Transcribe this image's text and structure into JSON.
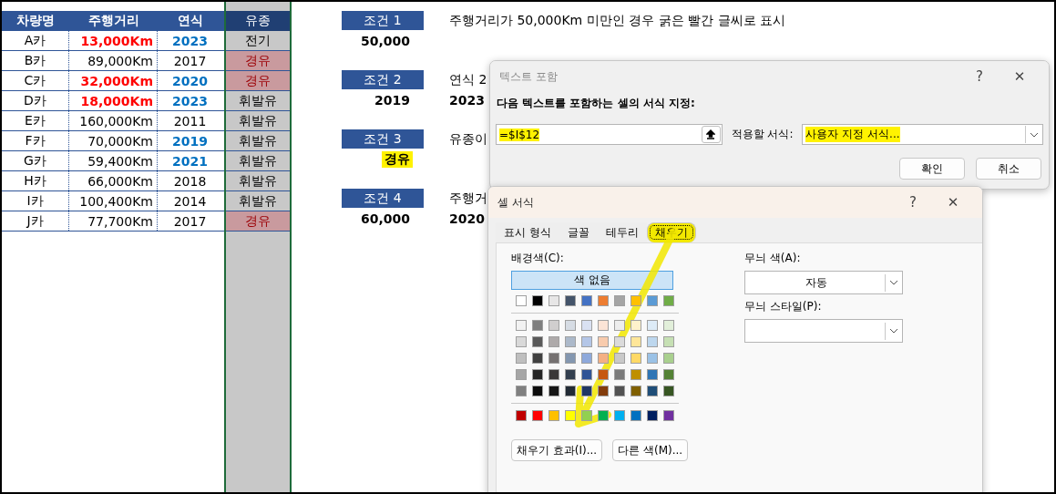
{
  "table": {
    "columns": [
      "차량명",
      "주행거리",
      "연식"
    ],
    "rows": [
      {
        "name": "A카",
        "distance": "13,000Km",
        "distance_flagged": true,
        "year": "2023",
        "year_flagged": true
      },
      {
        "name": "B카",
        "distance": "89,000Km",
        "distance_flagged": false,
        "year": "2017",
        "year_flagged": false
      },
      {
        "name": "C카",
        "distance": "32,000Km",
        "distance_flagged": true,
        "year": "2020",
        "year_flagged": true
      },
      {
        "name": "D카",
        "distance": "18,000Km",
        "distance_flagged": true,
        "year": "2023",
        "year_flagged": true
      },
      {
        "name": "E카",
        "distance": "160,000Km",
        "distance_flagged": false,
        "year": "2011",
        "year_flagged": false
      },
      {
        "name": "F카",
        "distance": "70,000Km",
        "distance_flagged": false,
        "year": "2019",
        "year_flagged": true
      },
      {
        "name": "G카",
        "distance": "59,400Km",
        "distance_flagged": false,
        "year": "2021",
        "year_flagged": true
      },
      {
        "name": "H카",
        "distance": "66,000Km",
        "distance_flagged": false,
        "year": "2018",
        "year_flagged": false
      },
      {
        "name": "I카",
        "distance": "100,400Km",
        "distance_flagged": false,
        "year": "2014",
        "year_flagged": false
      },
      {
        "name": "J카",
        "distance": "77,700Km",
        "distance_flagged": false,
        "year": "2017",
        "year_flagged": false
      }
    ]
  },
  "fuel_column": {
    "heading": "유종",
    "cells": [
      {
        "text": "전기",
        "flagged": false
      },
      {
        "text": "경유",
        "flagged": true
      },
      {
        "text": "경유",
        "flagged": true
      },
      {
        "text": "휘발유",
        "flagged": false
      },
      {
        "text": "휘발유",
        "flagged": false
      },
      {
        "text": "휘발유",
        "flagged": false
      },
      {
        "text": "휘발유",
        "flagged": false
      },
      {
        "text": "휘발유",
        "flagged": false
      },
      {
        "text": "휘발유",
        "flagged": false
      },
      {
        "text": "경유",
        "flagged": true
      }
    ]
  },
  "conditions": [
    {
      "label": "조건 1",
      "value": "50,000",
      "highlighted": false,
      "description": "주행거리가 50,000Km 미만인 경우 굵은 빨간 글씨로 표시"
    },
    {
      "label": "조건 2",
      "value": "2019",
      "highlighted": false,
      "description": "연식 2",
      "value_2": "2023"
    },
    {
      "label": "조건 3",
      "value": "경유",
      "highlighted": true,
      "description": "유종이"
    },
    {
      "label": "조건 4",
      "value": "60,000",
      "highlighted": false,
      "description": "주행거",
      "value_2": "2020"
    }
  ],
  "text_dialog": {
    "title": "텍스트 포함",
    "help": "?",
    "close": "✕",
    "prompt": "다음 텍스트를 포함하는 셀의 서식 지정:",
    "input_value": "=$I$12",
    "input_highlighted": true,
    "format_label": "적용할 서식:",
    "format_value": "사용자 지정 서식...",
    "format_highlighted": true,
    "buttons": [
      "확인",
      "취소"
    ]
  },
  "format_dialog": {
    "title": "셀 서식",
    "help": "?",
    "close": "✕",
    "tabs": [
      {
        "label": "표시 형식",
        "selected": false,
        "highlighted": false
      },
      {
        "label": "글꼴",
        "selected": false,
        "highlighted": false
      },
      {
        "label": "테두리",
        "selected": false,
        "highlighted": false
      },
      {
        "label": "채우기",
        "selected": true,
        "highlighted": true
      }
    ],
    "background_label": "배경색(C):",
    "no_color_button": "색 없음",
    "theme_colors": [
      {
        "color": "#ffffff"
      },
      {
        "color": "#000000"
      },
      {
        "color": "#e7e6e6"
      },
      {
        "color": "#44546a"
      },
      {
        "color": "#4472c4"
      },
      {
        "color": "#ed7d31"
      },
      {
        "color": "#a5a5a5"
      },
      {
        "color": "#ffc000"
      },
      {
        "color": "#5b9bd5"
      },
      {
        "color": "#70ad47"
      }
    ],
    "tint_rows": [
      [
        {
          "color": "#f2f2f2"
        },
        {
          "color": "#7f7f7f"
        },
        {
          "color": "#d0cece"
        },
        {
          "color": "#d6dce4"
        },
        {
          "color": "#d9e1f2"
        },
        {
          "color": "#fce4d6"
        },
        {
          "color": "#ededed"
        },
        {
          "color": "#fff2cc"
        },
        {
          "color": "#ddebf7"
        },
        {
          "color": "#e2efda"
        }
      ],
      [
        {
          "color": "#d9d9d9"
        },
        {
          "color": "#595959"
        },
        {
          "color": "#aeaaaa"
        },
        {
          "color": "#acb9ca"
        },
        {
          "color": "#b4c6e7"
        },
        {
          "color": "#f8cbad"
        },
        {
          "color": "#dbdbdb"
        },
        {
          "color": "#ffe699"
        },
        {
          "color": "#bdd7ee"
        },
        {
          "color": "#c6e0b4"
        }
      ],
      [
        {
          "color": "#bfbfbf"
        },
        {
          "color": "#404040"
        },
        {
          "color": "#757171"
        },
        {
          "color": "#8497b0"
        },
        {
          "color": "#8ea9db"
        },
        {
          "color": "#f4b084"
        },
        {
          "color": "#c9c9c9"
        },
        {
          "color": "#ffd966"
        },
        {
          "color": "#9bc2e6"
        },
        {
          "color": "#a9d08e"
        }
      ],
      [
        {
          "color": "#a6a6a6"
        },
        {
          "color": "#262626"
        },
        {
          "color": "#3a3838"
        },
        {
          "color": "#333f4f"
        },
        {
          "color": "#305496"
        },
        {
          "color": "#c65911"
        },
        {
          "color": "#7b7b7b"
        },
        {
          "color": "#bf8f00"
        },
        {
          "color": "#2f75b5"
        },
        {
          "color": "#548235"
        }
      ],
      [
        {
          "color": "#808080"
        },
        {
          "color": "#0d0d0d"
        },
        {
          "color": "#161616"
        },
        {
          "color": "#222b35"
        },
        {
          "color": "#203764"
        },
        {
          "color": "#833c0c"
        },
        {
          "color": "#525252"
        },
        {
          "color": "#806000"
        },
        {
          "color": "#1f4e78"
        },
        {
          "color": "#375623"
        }
      ]
    ],
    "standard_colors": [
      {
        "color": "#c00000"
      },
      {
        "color": "#ff0000"
      },
      {
        "color": "#ffc000"
      },
      {
        "color": "#ffff00"
      },
      {
        "color": "#92d050"
      },
      {
        "color": "#00b050"
      },
      {
        "color": "#00b0f0"
      },
      {
        "color": "#0070c0"
      },
      {
        "color": "#002060"
      },
      {
        "color": "#7030a0"
      }
    ],
    "buttons": [
      "채우기 효과(I)...",
      "다른 색(M)..."
    ],
    "pattern_color_label": "무늬 색(A):",
    "pattern_color_value": "자동",
    "pattern_style_label": "무늬 스타일(P):"
  }
}
